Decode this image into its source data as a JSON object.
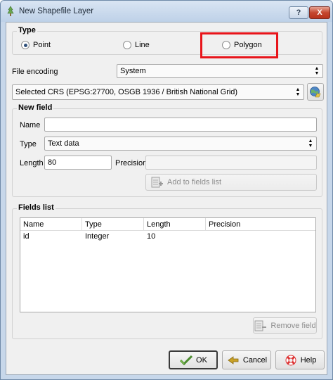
{
  "window": {
    "title": "New Shapefile Layer",
    "help_button": "?",
    "close_button": "X"
  },
  "type_group": {
    "title": "Type",
    "options": [
      {
        "label": "Point",
        "checked": true
      },
      {
        "label": "Line",
        "checked": false
      },
      {
        "label": "Polygon",
        "checked": false
      }
    ]
  },
  "file_encoding": {
    "label": "File encoding",
    "value": "System"
  },
  "crs": {
    "value": "Selected CRS (EPSG:27700, OSGB 1936 / British National Grid)",
    "select_icon": "globe-crs-icon"
  },
  "new_field": {
    "title": "New field",
    "name_label": "Name",
    "name_value": "",
    "type_label": "Type",
    "type_value": "Text data",
    "length_label": "Length",
    "length_value": "80",
    "precision_label": "Precision",
    "precision_value": "",
    "add_button": "Add to fields list"
  },
  "fields_list": {
    "title": "Fields list",
    "columns": [
      "Name",
      "Type",
      "Length",
      "Precision"
    ],
    "rows": [
      [
        "id",
        "Integer",
        "10",
        ""
      ]
    ],
    "remove_button": "Remove field"
  },
  "footer": {
    "ok": "OK",
    "cancel": "Cancel",
    "help": "Help"
  },
  "colors": {
    "highlight": "#e8151b",
    "title_bar": "#c7d7ea"
  }
}
